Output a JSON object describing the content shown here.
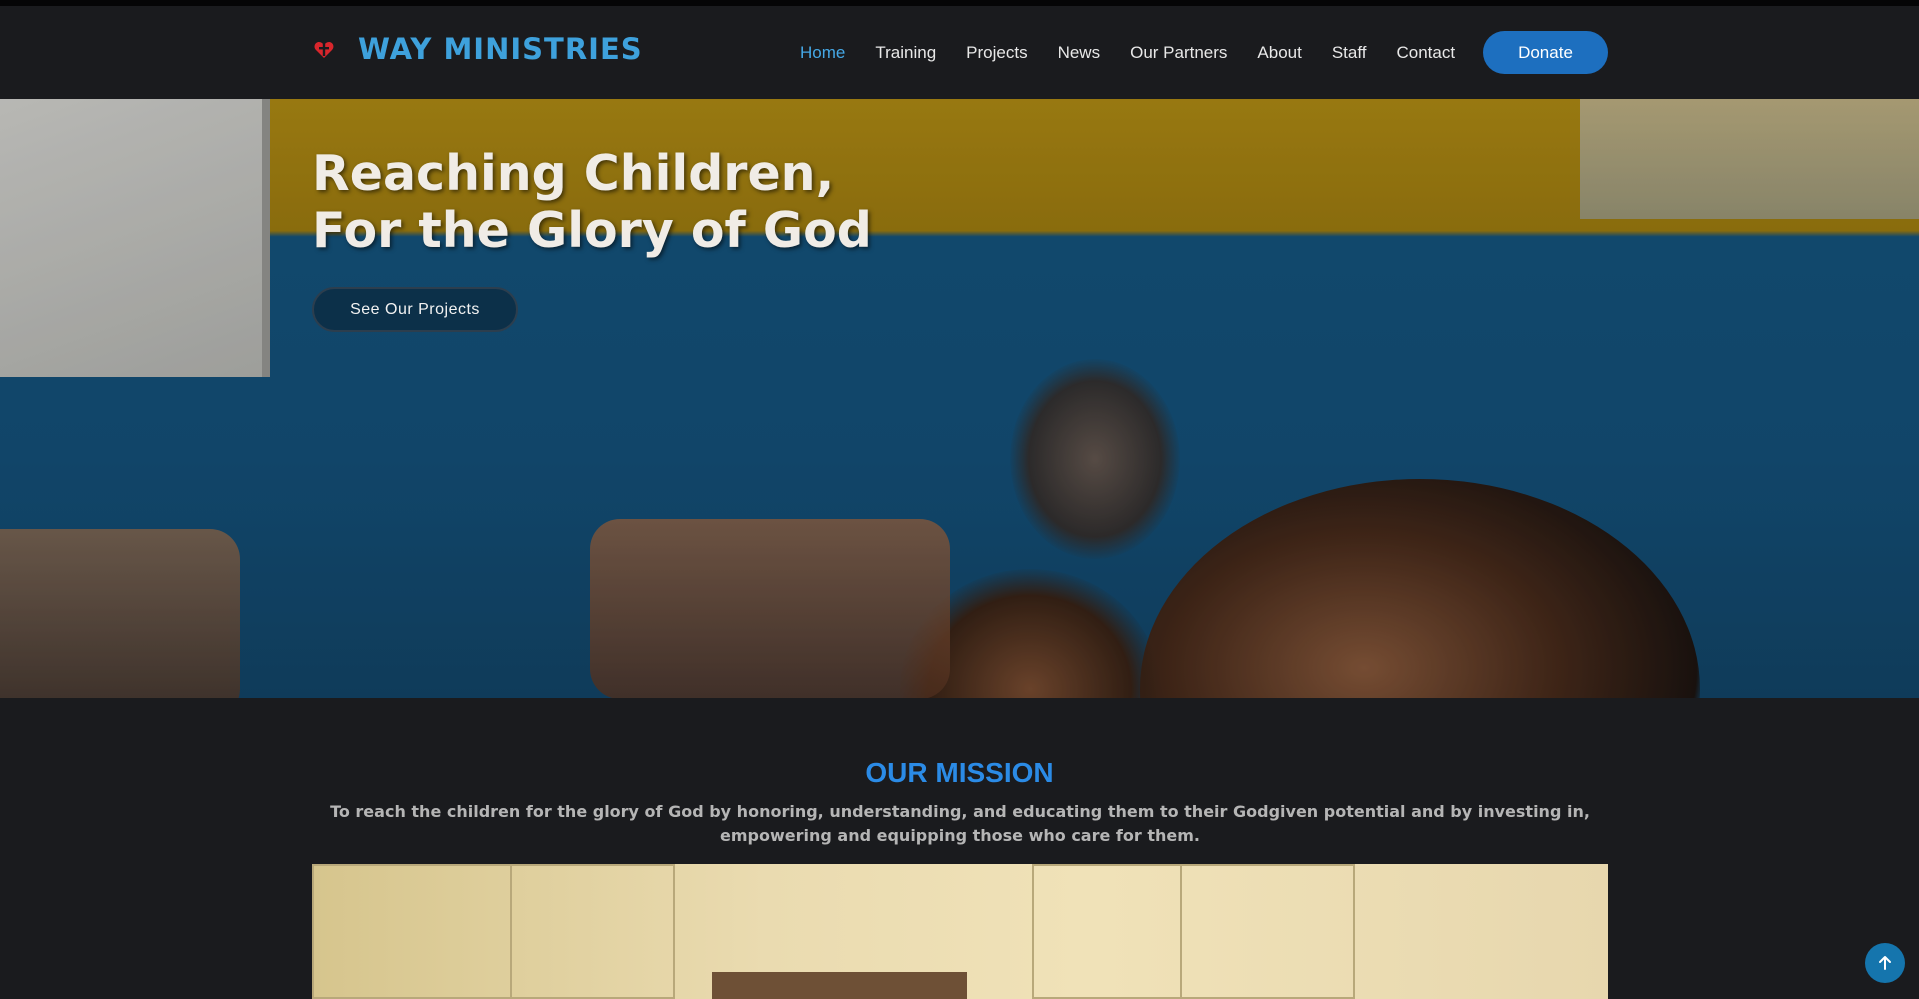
{
  "header": {
    "brand": "WAY MINISTRIES",
    "nav": [
      {
        "label": "Home",
        "active": true
      },
      {
        "label": "Training"
      },
      {
        "label": "Projects"
      },
      {
        "label": "News"
      },
      {
        "label": "Our Partners"
      },
      {
        "label": "About"
      },
      {
        "label": "Staff"
      },
      {
        "label": "Contact"
      }
    ],
    "donate_label": "Donate"
  },
  "hero": {
    "title_line1": "Reaching Children,",
    "title_line2": "For the Glory of God",
    "button_label": "See Our Projects"
  },
  "mission": {
    "title": "OUR MISSION",
    "text": "To reach the children for the glory of God by honoring, understanding, and educating them to their Godgiven potential and by investing in, empowering and equipping those who care for them."
  },
  "colors": {
    "accent": "#3ea1dc",
    "donate_bg": "#1d6fbf",
    "mission_title": "#2b8be6",
    "background": "#1a1b1e"
  },
  "icons": {
    "logo": "heart-cross-icon",
    "scroll_top": "arrow-up-icon"
  }
}
